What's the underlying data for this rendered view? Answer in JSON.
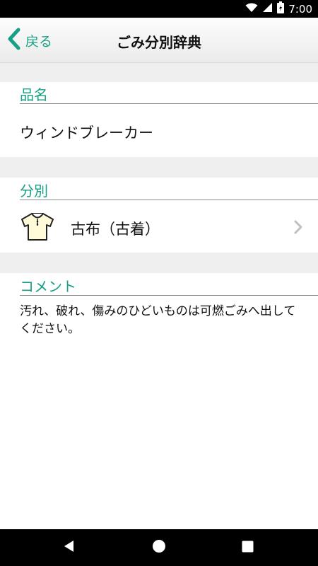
{
  "status_bar": {
    "time": "7:00",
    "icons": [
      "wifi-icon",
      "signal-icon",
      "battery-icon"
    ]
  },
  "header": {
    "back_label": "戻る",
    "title": "ごみ分別辞典"
  },
  "item": {
    "section_label": "品名",
    "name": "ウィンドブレーカー"
  },
  "category": {
    "section_label": "分別",
    "name": "古布（古着）",
    "icon": "shirt-icon"
  },
  "comment": {
    "section_label": "コメント",
    "text": "汚れ、破れ、傷みのひどいものは可燃ごみへ出してください。"
  },
  "nav": {
    "icons": [
      "back-triangle-icon",
      "home-circle-icon",
      "recents-square-icon"
    ]
  },
  "colors": {
    "accent": "#17a086",
    "gap": "#efefef",
    "status_bar": "#000000"
  }
}
